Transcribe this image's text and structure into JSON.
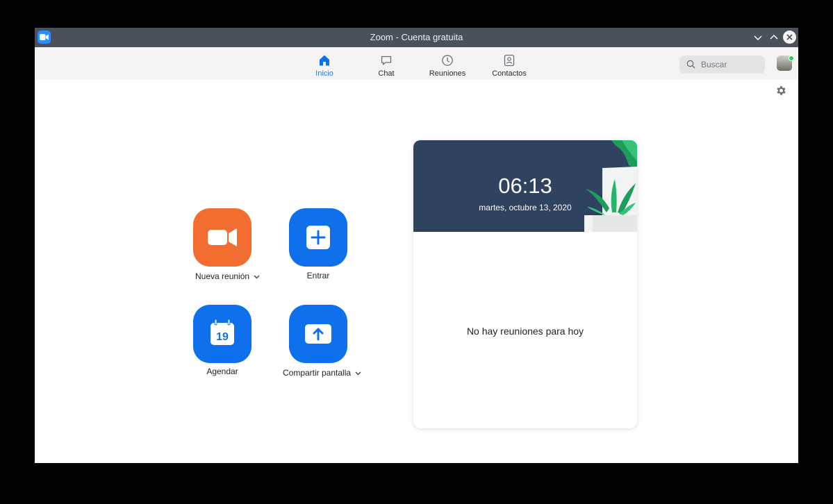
{
  "window": {
    "title": "Zoom - Cuenta gratuita"
  },
  "nav": {
    "tabs": [
      {
        "label": "Inicio",
        "icon": "home-icon",
        "active": true
      },
      {
        "label": "Chat",
        "icon": "chat-icon",
        "active": false
      },
      {
        "label": "Reuniones",
        "icon": "clock-icon",
        "active": false
      },
      {
        "label": "Contactos",
        "icon": "contacts-icon",
        "active": false
      }
    ]
  },
  "search": {
    "placeholder": "Buscar"
  },
  "actions": {
    "nueva": "Nueva reunión",
    "entrar": "Entrar",
    "agendar": "Agendar",
    "agendar_day": "19",
    "compartir": "Compartir pantalla"
  },
  "card": {
    "time": "06:13",
    "date": "martes, octubre 13, 2020",
    "empty_message": "No hay reuniones para hoy"
  },
  "colors": {
    "titlebar": "#4a5158",
    "accent_blue": "#0e71eb",
    "accent_orange": "#f26d30",
    "card_header": "#2f4360",
    "active_tab": "#2d7ae0",
    "presence": "#23d160"
  }
}
